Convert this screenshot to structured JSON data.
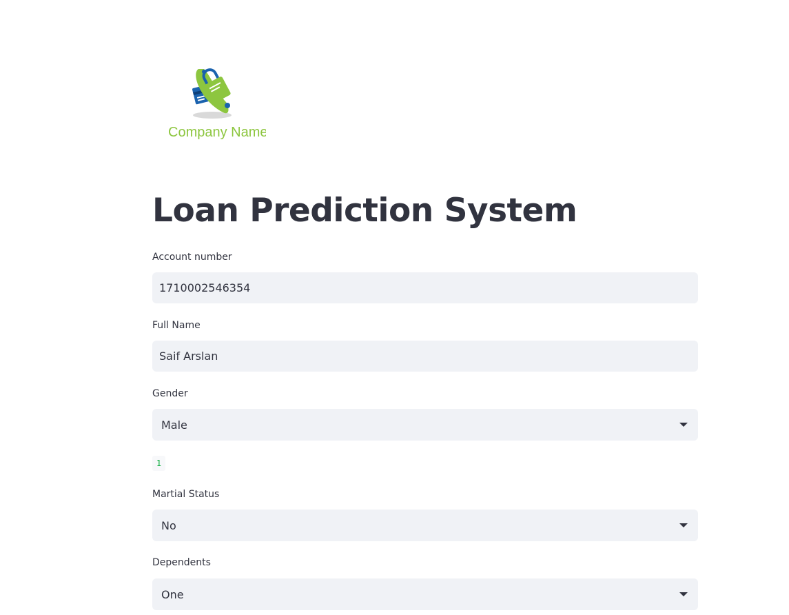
{
  "logo": {
    "text": "Company Name",
    "colors": {
      "green": "#8dc63f",
      "blue": "#1a62ae"
    }
  },
  "title": "Loan Prediction System",
  "fields": {
    "account_number": {
      "label": "Account number",
      "value": "1710002546354"
    },
    "full_name": {
      "label": "Full Name",
      "value": "Saif Arslan"
    },
    "gender": {
      "label": "Gender",
      "value": "Male"
    },
    "output_code": "1",
    "marital_status": {
      "label": "Martial Status",
      "value": "No"
    },
    "dependents": {
      "label": "Dependents",
      "value": "One"
    }
  },
  "colors": {
    "input_bg": "#f0f2f6",
    "text": "#31333f",
    "code_text": "#09ab3b"
  }
}
